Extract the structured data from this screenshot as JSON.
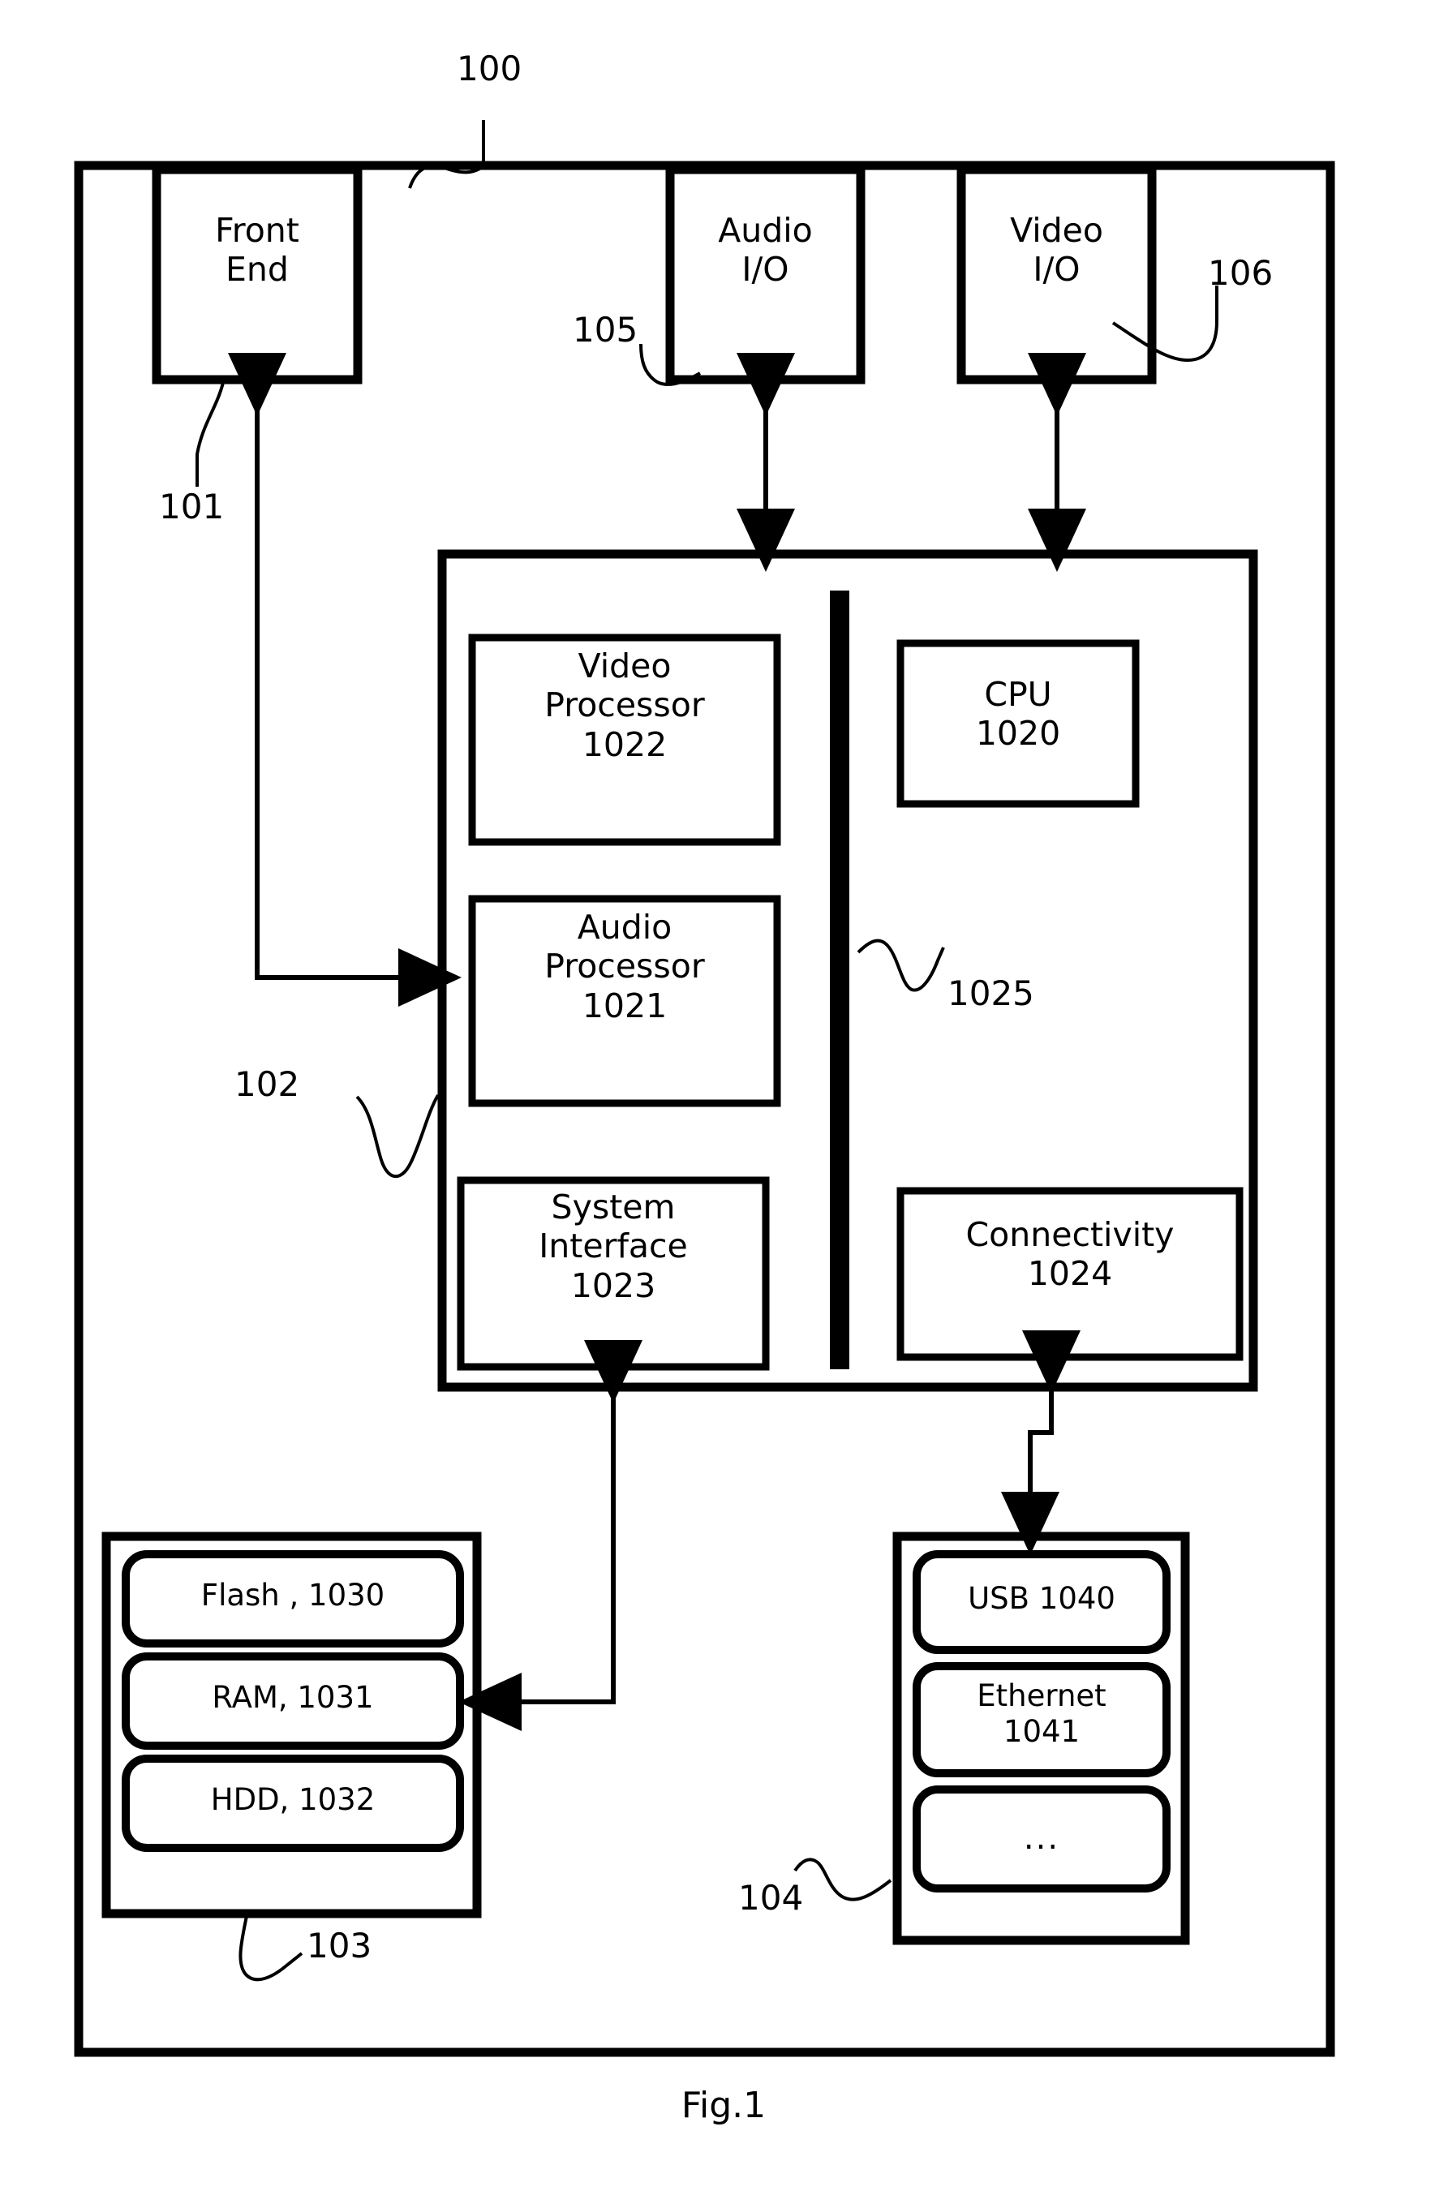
{
  "figure": {
    "caption": "Fig.1",
    "system_ref": "100"
  },
  "blocks": {
    "front_end": {
      "label": "Front\nEnd",
      "ref": "101"
    },
    "audio_io": {
      "label": "Audio\nI/O",
      "ref": "105"
    },
    "video_io": {
      "label": "Video\nI/O",
      "ref": "106"
    },
    "soc": {
      "ref": "102"
    },
    "bus": {
      "ref": "1025"
    },
    "video_processor": {
      "label": "Video\nProcessor\n1022"
    },
    "audio_processor": {
      "label": "Audio\nProcessor\n1021"
    },
    "system_interface": {
      "label": "System\nInterface\n1023"
    },
    "cpu": {
      "label": "CPU\n1020"
    },
    "connectivity": {
      "label": "Connectivity\n1024"
    },
    "memory": {
      "ref": "103",
      "items": [
        {
          "label": "Flash , 1030"
        },
        {
          "label": "RAM, 1031"
        },
        {
          "label": "HDD, 1032"
        }
      ]
    },
    "peripherals": {
      "ref": "104",
      "items": [
        {
          "label": "USB 1040"
        },
        {
          "label": "Ethernet\n1041"
        },
        {
          "label": "..."
        }
      ]
    }
  },
  "colors": {
    "ink": "#000000",
    "paper": "#ffffff"
  }
}
